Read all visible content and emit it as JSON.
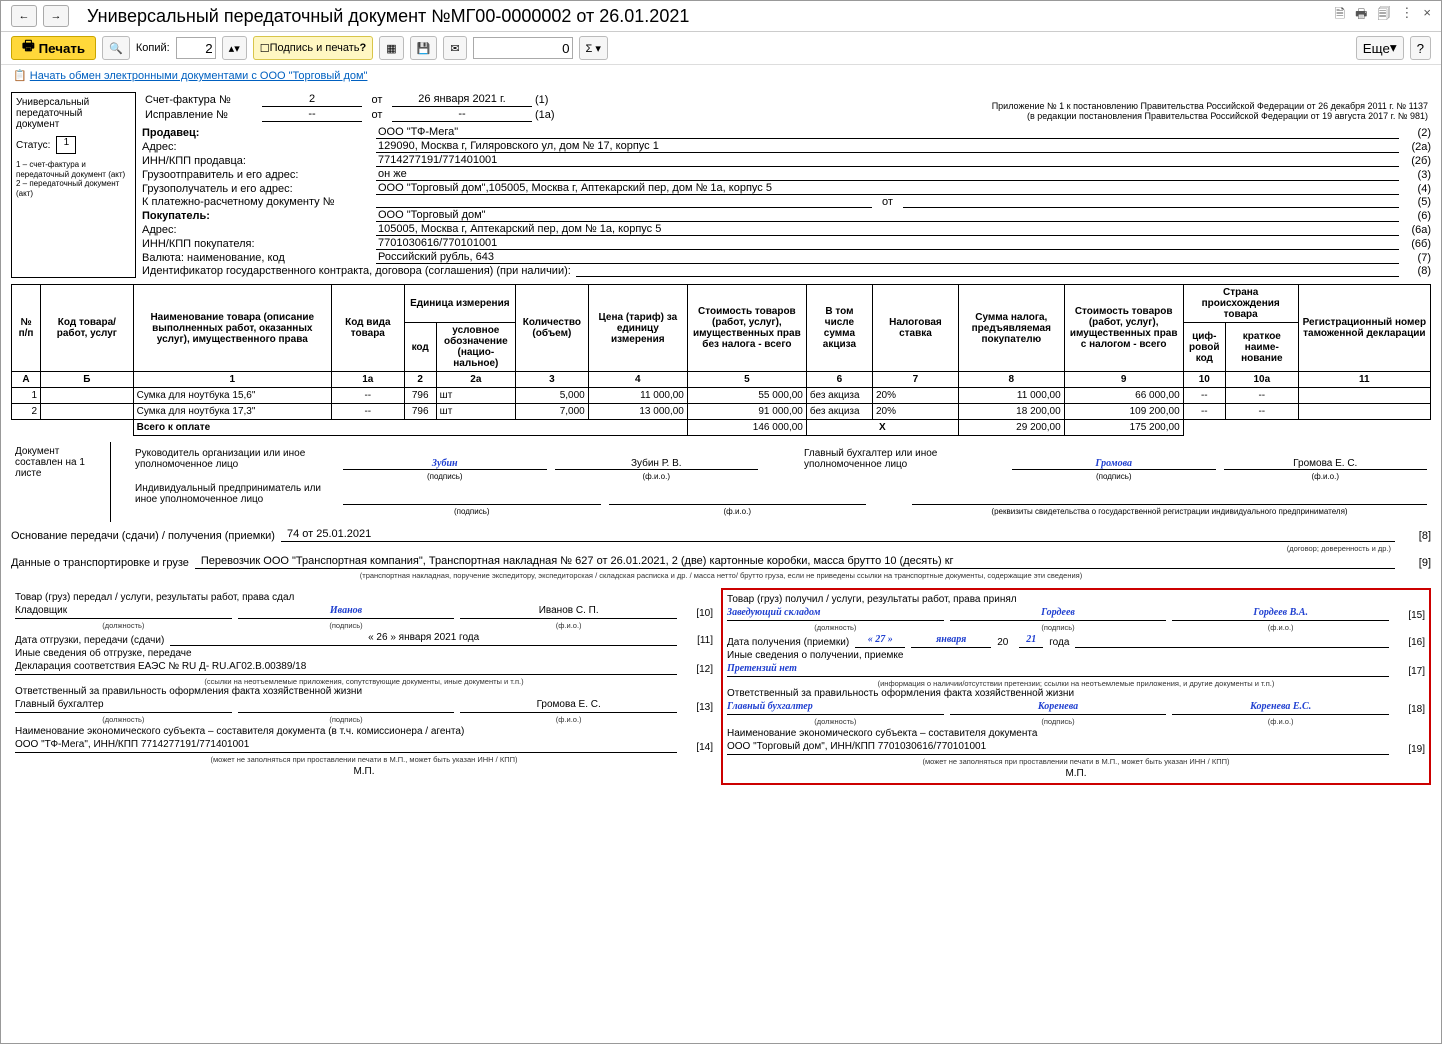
{
  "window": {
    "title": "Универсальный передаточный документ №МГ00-0000002 от 26.01.2021",
    "print_label": "Печать",
    "copies_label": "Копий:",
    "copies_value": "2",
    "sign_and_print": "Подпись и печать",
    "num_input": "0",
    "more_btn": "Еще",
    "help_btn": "?",
    "link_exchange": "Начать обмен электронными документами с ООО \"Торговый дом\""
  },
  "leftbox": {
    "title1": "Универсальный",
    "title2": "передаточный",
    "title3": "документ",
    "status_label": "Статус:",
    "status_value": "1",
    "note": "1 – счет-фактура и передаточный документ (акт)\n2 – передаточный документ (акт)"
  },
  "header": {
    "invoice_label": "Счет-фактура №",
    "invoice_no": "2",
    "invoice_from": "от",
    "invoice_date": "26 января 2021 г.",
    "invoice_ref": "(1)",
    "corr_label": "Исправление №",
    "corr_no": "--",
    "corr_from": "от",
    "corr_date": "--",
    "corr_ref": "(1а)",
    "legal1": "Приложение № 1 к постановлению Правительства Российской Федерации от 26 декабря 2011 г. № 1137",
    "legal2": "(в редакции постановления Правительства Российской Федерации от 19 августа 2017 г. № 981)"
  },
  "fields": [
    {
      "label": "Продавец:",
      "value": "ООО \"ТФ-Мега\"",
      "ref": "(2)",
      "bold": true
    },
    {
      "label": "Адрес:",
      "value": "129090, Москва г, Гиляровского ул, дом № 17, корпус 1",
      "ref": "(2а)"
    },
    {
      "label": "ИНН/КПП продавца:",
      "value": "7714277191/771401001",
      "ref": "(2б)"
    },
    {
      "label": "Грузоотправитель и его адрес:",
      "value": "он же",
      "ref": "(3)"
    },
    {
      "label": "Грузополучатель и его адрес:",
      "value": "ООО \"Торговый дом\",105005, Москва г, Аптекарский пер, дом № 1а, корпус 5",
      "ref": "(4)"
    },
    {
      "label": "К платежно-расчетному документу №",
      "value": "",
      "mid": "от",
      "value2": "",
      "ref": "(5)"
    },
    {
      "label": "Покупатель:",
      "value": "ООО \"Торговый дом\"",
      "ref": "(6)",
      "bold": true
    },
    {
      "label": "Адрес:",
      "value": "105005, Москва г, Аптекарский пер, дом № 1а, корпус 5",
      "ref": "(6а)"
    },
    {
      "label": "ИНН/КПП покупателя:",
      "value": "7701030616/770101001",
      "ref": "(6б)"
    },
    {
      "label": "Валюта: наименование, код",
      "value": "Российский рубль, 643",
      "ref": "(7)"
    },
    {
      "label": "Идентификатор государственного контракта, договора (соглашения) (при наличии):",
      "value": "",
      "ref": "(8)",
      "wide": true
    }
  ],
  "table": {
    "headers": {
      "no": "№ п/п",
      "code": "Код товара/ работ, услуг",
      "name": "Наименование товара (описание выполненных работ, оказанных услуг), имущественного права",
      "kind": "Код вида товара",
      "measure": "Единица измерения",
      "measure_code": "код",
      "measure_name": "условное обозна­чение (нацио­нальное)",
      "qty": "Коли­чество (объем)",
      "price": "Цена (тариф) за единицу измерения",
      "cost_wo_tax": "Стоимость товаров (работ, услуг), имущест­венных прав без налога - всего",
      "excise": "В том числе сумма акциза",
      "rate": "Налоговая ставка",
      "tax": "Сумма налога, предъяв­ляемая покупателю",
      "cost_w_tax": "Стоимость товаров (работ, услуг), имущест­венных прав с налогом - всего",
      "origin": "Страна происхождения товара",
      "origin_code": "циф­ро­вой код",
      "origin_name": "краткое наиме­нование",
      "gtd": "Регистрационный номер таможенной декларации"
    },
    "col_letters": [
      "А",
      "Б",
      "1",
      "1а",
      "2",
      "2а",
      "3",
      "4",
      "5",
      "6",
      "7",
      "8",
      "9",
      "10",
      "10а",
      "11"
    ],
    "rows": [
      {
        "no": "1",
        "code": "",
        "name": "Сумка для ноутбука 15,6\"",
        "kind": "--",
        "mcode": "796",
        "mname": "шт",
        "qty": "5,000",
        "price": "11 000,00",
        "cost": "55 000,00",
        "excise": "без акциза",
        "rate": "20%",
        "tax": "11 000,00",
        "total": "66 000,00",
        "oc": "--",
        "on": "--",
        "gtd": ""
      },
      {
        "no": "2",
        "code": "",
        "name": "Сумка для ноутбука 17,3\"",
        "kind": "--",
        "mcode": "796",
        "mname": "шт",
        "qty": "7,000",
        "price": "13 000,00",
        "cost": "91 000,00",
        "excise": "без акциза",
        "rate": "20%",
        "tax": "18 200,00",
        "total": "109 200,00",
        "oc": "--",
        "on": "--",
        "gtd": ""
      }
    ],
    "total_label": "Всего к оплате",
    "total_cost": "146 000,00",
    "total_x": "Х",
    "total_tax": "29 200,00",
    "total_sum": "175 200,00"
  },
  "signatures": {
    "doc_made": "Документ составлен на 1 листе",
    "head": "Руководитель организации или иное уполномоченное лицо",
    "head_sig": "Зубин",
    "head_name": "Зубин Р. В.",
    "acct": "Главный бухгалтер или иное уполномоченное лицо",
    "acct_sig": "Громова",
    "acct_name": "Громова Е. С.",
    "ip": "Индивидуальный предприниматель или иное уполномоченное лицо",
    "sig_lbl": "(подпись)",
    "fio_lbl": "(ф.и.о.)",
    "reg_lbl": "(реквизиты свидетельства о государственной  регистрации индивидуального предпринимателя)"
  },
  "basis": {
    "label": "Основание передачи (сдачи) / получения (приемки)",
    "value": "74 от 25.01.2021",
    "note": "(договор; доверенность и др.)",
    "ref": "[8]"
  },
  "transport": {
    "label": "Данные о транспортировке и грузе",
    "value": "Перевозчик ООО \"Транспортная компания\", Транспортная накладная № 627 от 26.01.2021, 2 (две) картонные коробки, масса брутто 10 (десять) кг",
    "note": "(транспортная накладная, поручение экспедитору, экспедиторская / складская расписка и др. / масса нетто/ брутто груза, если не приведены ссылки на транспортные документы, содержащие эти сведения)",
    "ref": "[9]"
  },
  "left_col": {
    "t1": "Товар (груз) передал / услуги, результаты работ, права сдал",
    "pos": "Кладовщик",
    "sig": "Иванов",
    "fio": "Иванов С. П.",
    "ref1": "[10]",
    "date_lbl": "Дата отгрузки, передачи (сдачи)",
    "date_val": "«  26  »     января    2021   года",
    "ref2": "[11]",
    "other_lbl": "Иные сведения об отгрузке, передаче",
    "other_val": "Декларация соответствия ЕАЭС № RU Д- RU.АГ02.В.00389/18",
    "other_note": "(ссылки на неотъемлемые приложения, сопутствующие документы, иные документы и т.п.)",
    "ref3": "[12]",
    "resp_lbl": "Ответственный за правильность оформления факта хозяйственной жизни",
    "resp_pos": "Главный бухгалтер",
    "resp_fio": "Громова Е. С.",
    "ref4": "[13]",
    "econ_lbl": "Наименование экономического субъекта – составителя документа (в т.ч. комиссионера / агента)",
    "econ_val": "ООО \"ТФ-Мега\", ИНН/КПП 7714277191/771401001",
    "econ_note": "(может не заполняться при проставлении печати в М.П., может быть указан ИНН / КПП)",
    "ref5": "[14]",
    "mp": "М.П."
  },
  "right_col": {
    "t1": "Товар (груз) получил / услуги, результаты работ, права принял",
    "pos": "Заведующий складом",
    "sig": "Гордеев",
    "fio": "Гордеев В.А.",
    "ref1": "[15]",
    "date_lbl": "Дата получения (приемки)",
    "date_d": "« 27 »",
    "date_m": "января",
    "date_y": "2021",
    "date_y2": "года",
    "ref2": "[16]",
    "other_lbl": "Иные сведения о получении, приемке",
    "other_val": "Претензий нет",
    "other_note": "(информация о наличии/отсутствии претензии; ссылки на неотъемлемые приложения, и другие  документы и т.п.)",
    "ref3": "[17]",
    "resp_lbl": "Ответственный за правильность оформления факта хозяйственной жизни",
    "resp_pos": "Главный бухгалтер",
    "resp_sig": "Коренева",
    "resp_fio": "Коренева Е.С.",
    "ref4": "[18]",
    "econ_lbl": "Наименование экономического субъекта – составителя документа",
    "econ_val": "ООО \"Торговый дом\", ИНН/КПП 7701030616/770101001",
    "econ_note": "(может не заполняться при проставлении печати в М.П., может быть указан ИНН / КПП)",
    "ref5": "[19]",
    "mp": "М.П."
  },
  "lbls": {
    "pos": "(должность)",
    "sig": "(подпись)",
    "fio": "(ф.и.о.)"
  }
}
